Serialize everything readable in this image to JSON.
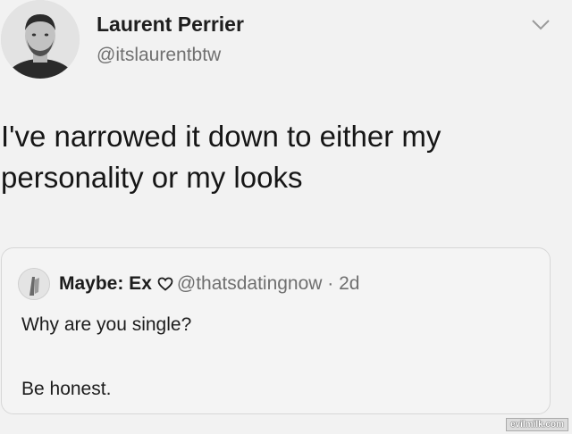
{
  "author": {
    "name": "Laurent Perrier",
    "handle": "@itslaurentbtw",
    "avatar_icon": "profile-photo-icon"
  },
  "menu": {
    "icon": "chevron-down-icon"
  },
  "tweet": {
    "text_line1": "I've narrowed it down to either my",
    "text_line2": "personality or my looks"
  },
  "quote": {
    "author_name": "Maybe: Ex",
    "heart_icon": "heart-outline-icon",
    "handle_time": "@thatsdatingnow · 2d",
    "line1": "Why are you single?",
    "line2": "Be honest."
  },
  "watermark": "evilmilk.com",
  "colors": {
    "background": "#f2f2f2",
    "text": "#1a1a1a",
    "secondary_text": "#707070",
    "card_border": "#d7d7d7"
  }
}
